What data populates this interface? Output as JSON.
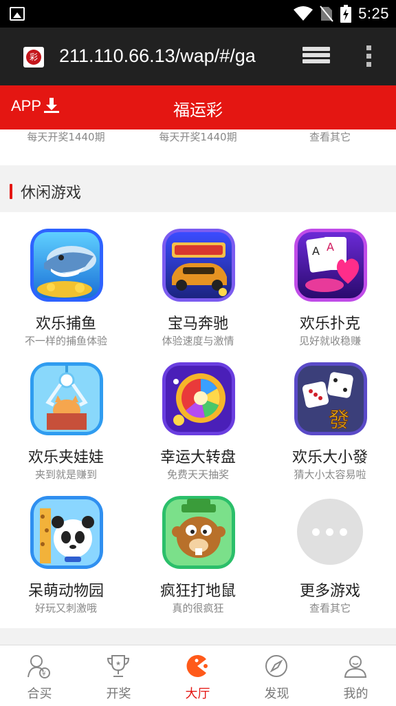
{
  "status_bar": {
    "time": "5:25"
  },
  "address_bar": {
    "favicon_text": "彩",
    "url": "211.110.66.13/wap/#/ga"
  },
  "app_bar": {
    "download_label": "APP",
    "title": "福运彩"
  },
  "partial_row": [
    "每天开奖1440期",
    "每天开奖1440期",
    "查看其它"
  ],
  "section": {
    "title": "休闲游戏"
  },
  "games": [
    {
      "name": "欢乐捕鱼",
      "subtitle": "不一样的捕鱼体验",
      "icon": "shark-fishing-icon"
    },
    {
      "name": "宝马奔驰",
      "subtitle": "体验速度与激情",
      "icon": "racing-car-icon"
    },
    {
      "name": "欢乐扑克",
      "subtitle": "见好就收稳赚",
      "icon": "poker-cards-icon"
    },
    {
      "name": "欢乐夹娃娃",
      "subtitle": "夹到就是赚到",
      "icon": "claw-machine-icon"
    },
    {
      "name": "幸运大转盘",
      "subtitle": "免费天天抽奖",
      "icon": "prize-wheel-icon"
    },
    {
      "name": "欢乐大小發",
      "subtitle": "猜大小太容易啦",
      "icon": "dice-icon"
    },
    {
      "name": "呆萌动物园",
      "subtitle": "好玩又刺激哦",
      "icon": "zoo-animals-icon"
    },
    {
      "name": "疯狂打地鼠",
      "subtitle": "真的很疯狂",
      "icon": "whack-mole-icon"
    },
    {
      "name": "更多游戏",
      "subtitle": "查看其它",
      "icon": "more-dots-icon"
    }
  ],
  "bottom_nav": [
    {
      "label": "合买",
      "icon": "group-buy-icon",
      "active": false
    },
    {
      "label": "开奖",
      "icon": "trophy-icon",
      "active": false
    },
    {
      "label": "大厅",
      "icon": "hall-icon",
      "active": true
    },
    {
      "label": "发现",
      "icon": "compass-icon",
      "active": false
    },
    {
      "label": "我的",
      "icon": "profile-icon",
      "active": false
    }
  ],
  "colors": {
    "brand_red": "#e41612",
    "status_bar": "#000000",
    "address_bar": "#212121"
  }
}
